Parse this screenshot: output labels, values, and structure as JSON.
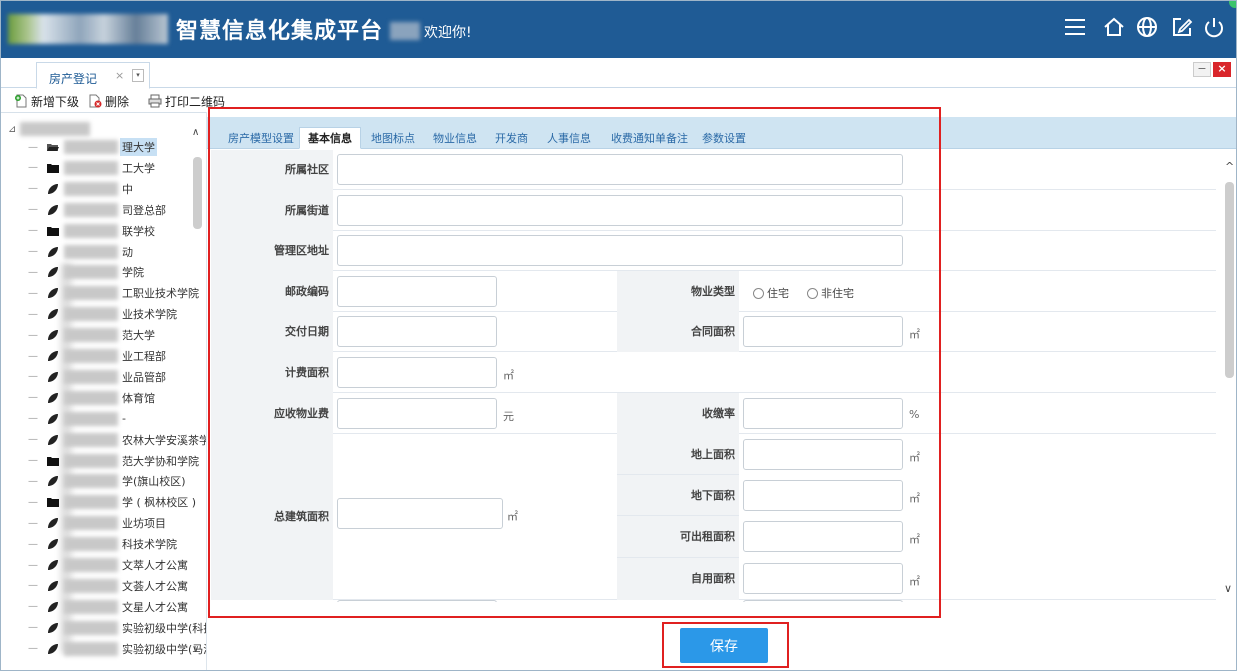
{
  "header": {
    "title": "智慧信息化集成平台",
    "welcome": "欢迎你!",
    "brand_color": "#1f5b95",
    "icons": [
      "menu-icon",
      "home-icon",
      "globe-icon",
      "edit-icon",
      "power-icon"
    ]
  },
  "tabs": [
    {
      "label": "房产登记",
      "close": "×",
      "dropdown": "▾"
    }
  ],
  "window": {
    "minimize": "−",
    "close": "×"
  },
  "toolbar": {
    "add": "新增下级",
    "delete": "删除",
    "print": "打印二维码"
  },
  "tree": {
    "items": [
      {
        "label": "理大学",
        "icon": "folder-open-icon",
        "selected": true
      },
      {
        "label": "工大学",
        "icon": "folder-icon"
      },
      {
        "label": "中",
        "icon": "leaf-icon"
      },
      {
        "label": "司登总部",
        "icon": "leaf-icon"
      },
      {
        "label": "联学校",
        "icon": "folder-icon"
      },
      {
        "label": "动",
        "icon": "leaf-icon"
      },
      {
        "label": "学院",
        "icon": "leaf-icon"
      },
      {
        "label": "工职业技术学院",
        "icon": "leaf-icon"
      },
      {
        "label": "业技术学院",
        "icon": "leaf-icon"
      },
      {
        "label": "范大学",
        "icon": "leaf-icon"
      },
      {
        "label": "业工程部",
        "icon": "leaf-icon"
      },
      {
        "label": "业品管部",
        "icon": "leaf-icon"
      },
      {
        "label": "体育馆",
        "icon": "leaf-icon"
      },
      {
        "label": "-",
        "icon": "leaf-icon"
      },
      {
        "label": "农林大学安溪茶学院",
        "icon": "leaf-icon"
      },
      {
        "label": "范大学协和学院",
        "icon": "folder-icon"
      },
      {
        "label": "学(旗山校区)",
        "icon": "leaf-icon"
      },
      {
        "label": "学 ( 枫林校区 )",
        "icon": "folder-icon"
      },
      {
        "label": "业坊项目",
        "icon": "leaf-icon"
      },
      {
        "label": "科技术学院",
        "icon": "leaf-icon"
      },
      {
        "label": "文萃人才公寓",
        "icon": "leaf-icon"
      },
      {
        "label": "文荟人才公寓",
        "icon": "leaf-icon"
      },
      {
        "label": "文星人才公寓",
        "icon": "leaf-icon"
      },
      {
        "label": "实验初级中学(科技城",
        "icon": "leaf-icon"
      },
      {
        "label": "实验初级中学(马渡路",
        "icon": "leaf-icon"
      }
    ]
  },
  "panel_tabs": [
    {
      "label": "房产模型设置",
      "active": false
    },
    {
      "label": "基本信息",
      "active": true
    },
    {
      "label": "地图标点",
      "active": false
    },
    {
      "label": "物业信息",
      "active": false
    },
    {
      "label": "开发商",
      "active": false
    },
    {
      "label": "人事信息",
      "active": false
    },
    {
      "label": "收费通知单备注",
      "active": false
    },
    {
      "label": "参数设置",
      "active": false
    }
  ],
  "form": {
    "community": {
      "label": "所属社区",
      "value": ""
    },
    "street": {
      "label": "所属街道",
      "value": ""
    },
    "district_address": {
      "label": "管理区地址",
      "value": ""
    },
    "postcode": {
      "label": "邮政编码",
      "value": ""
    },
    "property_type": {
      "label": "物业类型",
      "options": [
        "住宅",
        "非住宅"
      ]
    },
    "delivery_date": {
      "label": "交付日期",
      "value": ""
    },
    "contract_area": {
      "label": "合同面积",
      "value": "",
      "unit": "㎡"
    },
    "billing_area": {
      "label": "计费面积",
      "value": "",
      "unit": "㎡"
    },
    "property_fee": {
      "label": "应收物业费",
      "value": "",
      "unit": "元"
    },
    "collection_rate": {
      "label": "收缴率",
      "value": "",
      "unit": "%"
    },
    "total_area": {
      "label": "总建筑面积",
      "value": "",
      "unit": "㎡"
    },
    "above_ground_area": {
      "label": "地上面积",
      "value": "",
      "unit": "㎡"
    },
    "underground_area": {
      "label": "地下面积",
      "value": "",
      "unit": "㎡"
    },
    "rentable_area": {
      "label": "可出租面积",
      "value": "",
      "unit": "㎡"
    },
    "self_use_area": {
      "label": "自用面积",
      "value": "",
      "unit": "㎡"
    }
  },
  "footer": {
    "save": "保存"
  }
}
